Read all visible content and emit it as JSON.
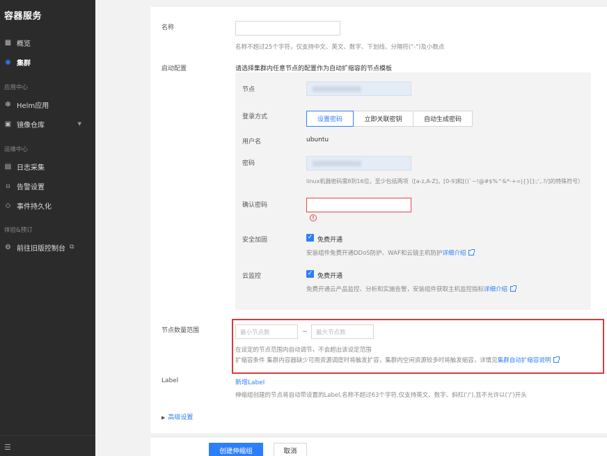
{
  "sidebar": {
    "title": "容器服务",
    "items": [
      {
        "label": "概览",
        "icon": "grid-icon"
      },
      {
        "label": "集群",
        "icon": "cluster-icon"
      },
      {
        "label": "Helm应用",
        "icon": "helm-icon"
      },
      {
        "label": "镜像仓库",
        "icon": "registry-icon"
      },
      {
        "label": "日志采集",
        "icon": "log-icon"
      },
      {
        "label": "告警设置",
        "icon": "alarm-icon"
      },
      {
        "label": "事件持久化",
        "icon": "event-icon"
      },
      {
        "label": "前往旧版控制台",
        "icon": "console-icon"
      }
    ],
    "groups": [
      "应用中心",
      "运维中心",
      "体验&预订"
    ]
  },
  "form": {
    "name": {
      "label": "名称",
      "hint": "名称不超过25个字符，仅支持中文、英文、数字、下划线、分隔符(\"-\")及小数点"
    },
    "launch_config": {
      "label": "启动配置",
      "hint": "请选择集群内任意节点的配置作为自动扩缩容的节点模板",
      "node_label": "节点",
      "login_label": "登录方式",
      "login_options": [
        "设置密码",
        "立即关联密钥",
        "自动生成密码"
      ],
      "login_selected": "设置密码",
      "username_label": "用户名",
      "username_value": "ubuntu",
      "password_label": "密码",
      "password_hint": "linux机器密码需8到16位，至少包括两项（[a-z,A-Z]，[0-9]和[()`~!@#$%^&*-+=|{}[]:;',.?/]的特殊符号）",
      "confirm_label": "确认密码",
      "security_label": "安全加固",
      "security_check": "免费开通",
      "security_hint": "安装组件免费开通DDoS防护、WAF和云镜主机防护",
      "security_link": "详细介绍",
      "monitor_label": "云监控",
      "monitor_check": "免费开通",
      "monitor_hint": "免费开通云产品监控、分析和实施告警，安装组件获取主机监控指标",
      "monitor_link": "详细介绍"
    },
    "node_range": {
      "label": "节点数量范围",
      "min_placeholder": "最小节点数",
      "separator": "~",
      "max_placeholder": "最大节点数",
      "hint1": "在设定的节点范围内自动调节，不会超出该设定范围",
      "hint2": "扩缩容条件 集群内容器缺少可用资源调度时将触发扩容，集群内空闲资源较多时将触发缩容，详情见",
      "hint2_link": "集群自动扩缩容说明"
    },
    "label_section": {
      "label": "Label",
      "add_link": "新增Label",
      "hint": "伸缩组创建的节点将自动带设置的Label,名称不超过63个字符,仅支持英文、数字、斜杠('/'),且不允许以('/')开头"
    },
    "advanced": "高级设置"
  },
  "footer": {
    "create": "创建伸缩组",
    "cancel": "取消"
  },
  "colors": {
    "accent": "#2d7ff9",
    "error": "#e54545",
    "sidebar": "#2b2b2b"
  }
}
